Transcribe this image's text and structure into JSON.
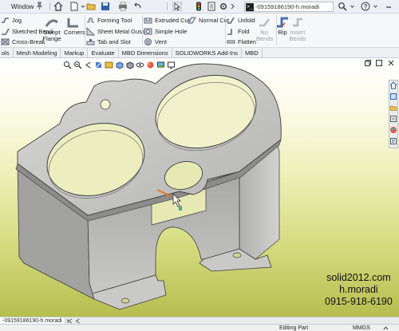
{
  "titlebar": {
    "window_menu": "Window",
    "search_text": "-09159186190-h.moradi"
  },
  "ribbon": {
    "jog": "Jog",
    "sketched_bend": "Sketched Bend",
    "cross_break": "Cross-Break",
    "swept_flange": "Swept Flange",
    "corners": "Corners",
    "forming_tool": "Forming Tool",
    "sheet_metal_gusset": "Sheet Metal Gusset",
    "tab_and_slot": "Tab and Slot",
    "extruded_cut": "Extruded Cut",
    "simple_hole": "Simple Hole",
    "vent": "Vent",
    "normal_cut": "Normal Cut",
    "unfold": "Unfold",
    "fold": "Fold",
    "flatten": "Flatten",
    "no_bends": "No Bends",
    "rip": "Rip",
    "insert_bends": "Insert Bends"
  },
  "tabs": [
    "ols",
    "Mesh Modeling",
    "Markup",
    "Evaluate",
    "MBD Dimensions",
    "SOLIDWORKS Add-Ins",
    "MBD"
  ],
  "watermark": {
    "line1": "solid2012.com",
    "line2": "h.moradi",
    "line3": "0915-918-6190"
  },
  "doc_tab": "-09159186190-h.moradi",
  "status": {
    "mode": "Editing Part",
    "units": "MMGS"
  },
  "colors": {
    "viewport_top": "#ffffff",
    "viewport_bottom": "#b8bd4f",
    "part_gray": "#c4c4c2",
    "selected_edge": "#e87a1c"
  }
}
